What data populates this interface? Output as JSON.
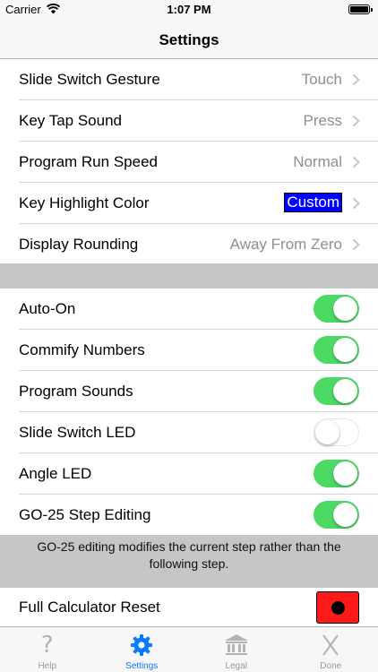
{
  "status_bar": {
    "carrier": "Carrier",
    "time": "1:07 PM"
  },
  "nav": {
    "title": "Settings"
  },
  "pickers": [
    {
      "label": "Slide Switch Gesture",
      "value": "Touch",
      "highlight": false
    },
    {
      "label": "Key Tap Sound",
      "value": "Press",
      "highlight": false
    },
    {
      "label": "Program Run Speed",
      "value": "Normal",
      "highlight": false
    },
    {
      "label": "Key Highlight Color",
      "value": "Custom",
      "highlight": true
    },
    {
      "label": "Display Rounding",
      "value": "Away From Zero",
      "highlight": false
    }
  ],
  "toggles": [
    {
      "label": "Auto-On",
      "on": true
    },
    {
      "label": "Commify Numbers",
      "on": true
    },
    {
      "label": "Program Sounds",
      "on": true
    },
    {
      "label": "Slide Switch LED",
      "on": false
    },
    {
      "label": "Angle LED",
      "on": true
    },
    {
      "label": "GO-25 Step Editing",
      "on": true
    }
  ],
  "footer_note": "GO-25 editing modifies the current step rather than the following step.",
  "reset": {
    "label": "Full Calculator Reset"
  },
  "tabs": [
    {
      "label": "Help",
      "icon": "question-icon",
      "active": false
    },
    {
      "label": "Settings",
      "icon": "gear-icon",
      "active": true
    },
    {
      "label": "Legal",
      "icon": "bank-icon",
      "active": false
    },
    {
      "label": "Done",
      "icon": "close-icon",
      "active": false
    }
  ],
  "colors": {
    "toggle_on": "#4cd964",
    "tab_active": "#0a7aff",
    "highlight": "#0000ff",
    "reset": "#ff1a1a"
  }
}
